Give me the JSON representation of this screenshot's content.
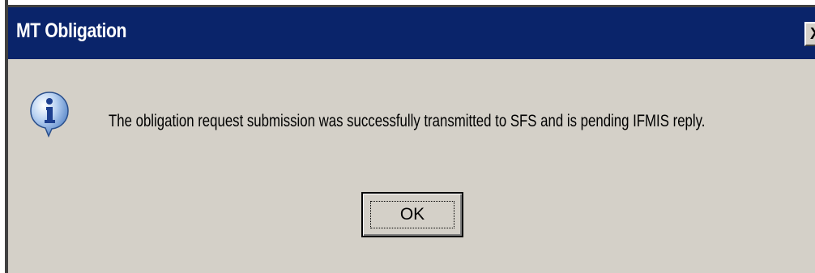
{
  "dialog": {
    "title": "MT Obligation",
    "close_glyph": "X",
    "icon": "info-icon",
    "message": "The obligation request submission was successfully transmitted to SFS and is pending IFMIS reply.",
    "ok_label": "OK"
  },
  "colors": {
    "titlebar": "#0a246a",
    "dialog_bg": "#d4d0c8",
    "text": "#000000"
  }
}
